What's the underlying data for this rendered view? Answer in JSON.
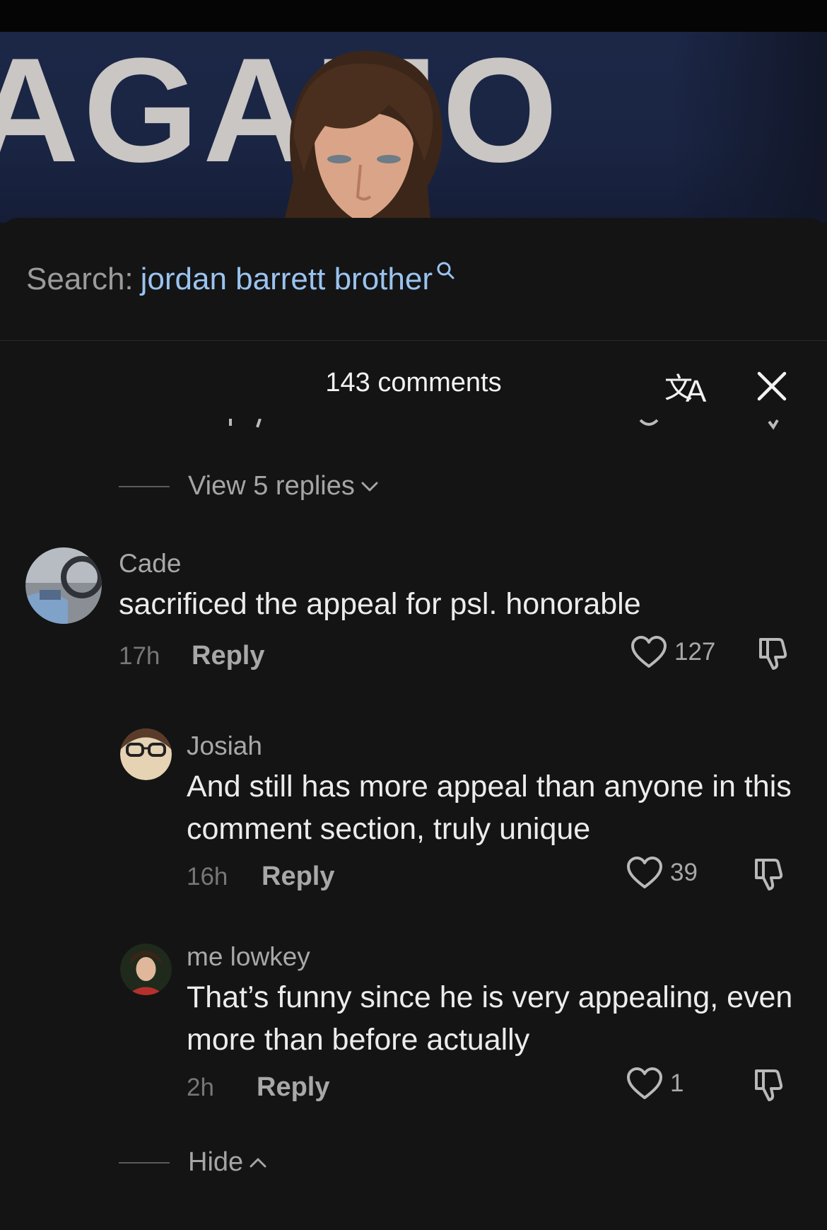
{
  "video": {
    "banner_text": "AGAMO"
  },
  "search": {
    "label": "Search:",
    "query": "jordan barrett brother"
  },
  "header": {
    "comments_count": "143 comments"
  },
  "replies_toggle": {
    "view_label": "View 5 replies",
    "hide_label": "Hide"
  },
  "comments": [
    {
      "author": "Cade",
      "text": "sacrificed the appeal for psl. honorable",
      "time": "17h",
      "reply_label": "Reply",
      "likes": "127"
    },
    {
      "author": "Josiah",
      "text": "And still has more appeal than anyone in this comment section, truly unique",
      "time": "16h",
      "reply_label": "Reply",
      "likes": "39"
    },
    {
      "author": "me lowkey",
      "text": "That’s funny since he is very appealing, even more than before actually",
      "time": "2h",
      "reply_label": "Reply",
      "likes": "1"
    }
  ],
  "colors": {
    "background": "#141415",
    "search_query": "#9ac3ef",
    "muted_text": "#a8a8a8"
  },
  "icons": [
    "search-icon",
    "translate-icon",
    "close-icon",
    "chevron-down-icon",
    "heart-icon",
    "dislike-icon",
    "chevron-up-icon"
  ]
}
